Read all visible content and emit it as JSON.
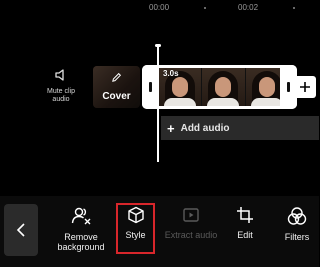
{
  "timeline": {
    "ruler": [
      "00:00",
      "00:02"
    ],
    "mute_label": "Mute clip\naudio",
    "cover_label": "Cover",
    "clip_duration": "3.0s",
    "add_audio_label": "Add audio",
    "add_audio_plus": "+"
  },
  "toolbar": {
    "back_icon": "chevron-left-icon",
    "items": [
      {
        "label": "Remove\nbackground",
        "icon": "remove-background-icon",
        "enabled": true
      },
      {
        "label": "Style",
        "icon": "cube-icon",
        "enabled": true,
        "highlighted": true
      },
      {
        "label": "Extract audio",
        "icon": "extract-audio-icon",
        "enabled": false
      },
      {
        "label": "Edit",
        "icon": "crop-icon",
        "enabled": true
      },
      {
        "label": "Filters",
        "icon": "filters-icon",
        "enabled": true
      }
    ]
  },
  "colors": {
    "background": "#000000",
    "highlight": "#d8262b",
    "audio_bar": "#2a2a2a",
    "disabled_text": "#5a5a5a"
  }
}
